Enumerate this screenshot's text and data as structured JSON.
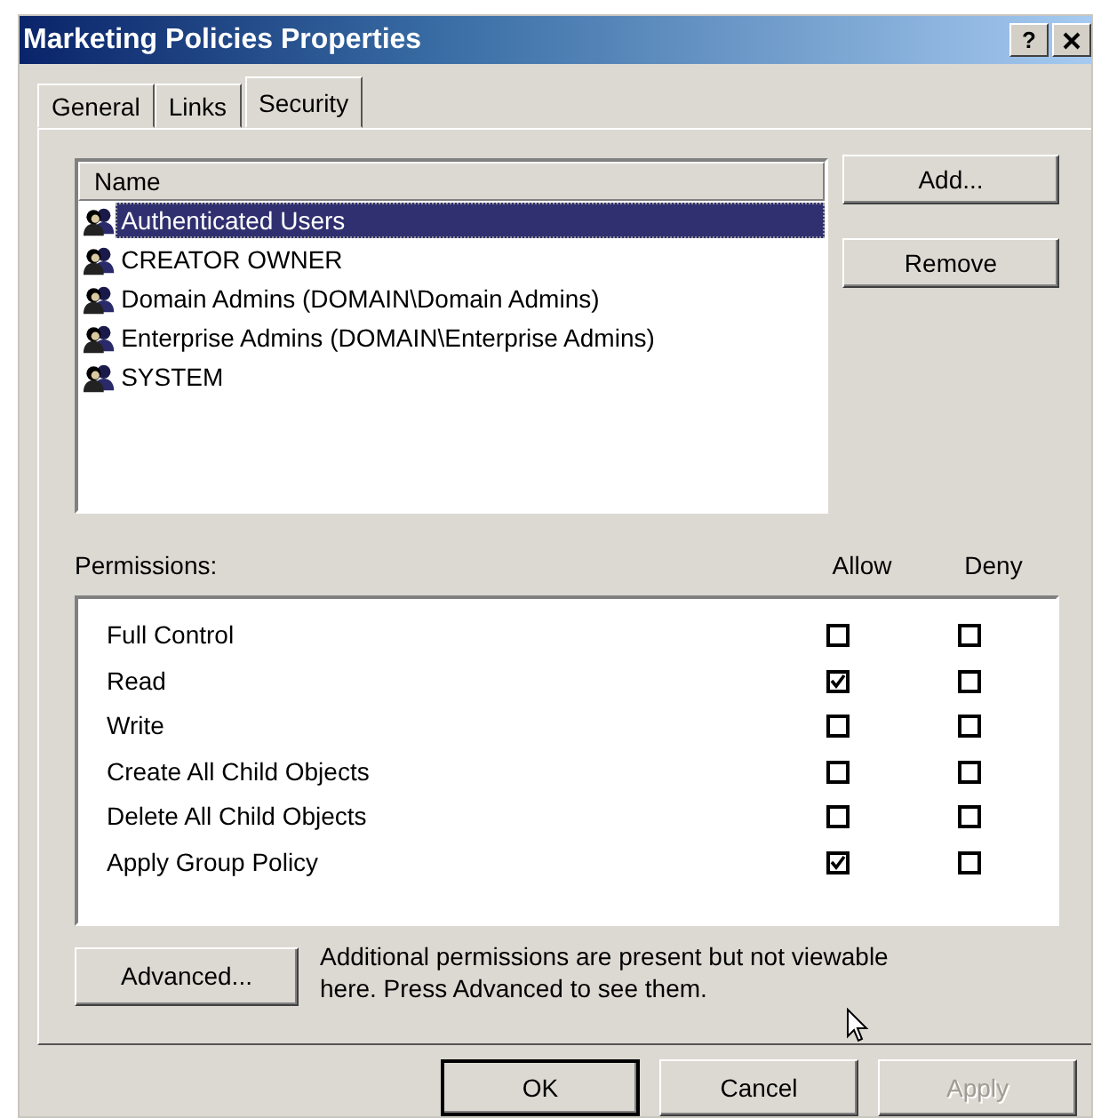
{
  "window": {
    "title": "Marketing Policies Properties",
    "help_button": "?"
  },
  "tabs": [
    {
      "label": "General",
      "selected": false
    },
    {
      "label": "Links",
      "selected": false
    },
    {
      "label": "Security",
      "selected": true
    }
  ],
  "users": {
    "column": "Name",
    "items": [
      {
        "name": "Authenticated Users",
        "selected": true
      },
      {
        "name": "CREATOR OWNER",
        "selected": false
      },
      {
        "name": "Domain Admins (DOMAIN\\Domain Admins)",
        "selected": false
      },
      {
        "name": "Enterprise Admins (DOMAIN\\Enterprise Admins)",
        "selected": false
      },
      {
        "name": "SYSTEM",
        "selected": false
      }
    ]
  },
  "user_buttons": [
    {
      "label": "Add...",
      "disabled": false
    },
    {
      "label": "Remove",
      "disabled": false
    }
  ],
  "permissions": {
    "label": "Permissions:",
    "allow_header": "Allow",
    "deny_header": "Deny",
    "rows": [
      {
        "name": "Full Control",
        "allow": false,
        "deny": false
      },
      {
        "name": "Read",
        "allow": true,
        "deny": false
      },
      {
        "name": "Write",
        "allow": false,
        "deny": false
      },
      {
        "name": "Create All Child Objects",
        "allow": false,
        "deny": false
      },
      {
        "name": "Delete All Child Objects",
        "allow": false,
        "deny": false
      },
      {
        "name": "Apply Group Policy",
        "allow": true,
        "deny": false
      }
    ]
  },
  "advanced": {
    "button": "Advanced...",
    "note": "Additional permissions are present but not viewable here. Press Advanced to see them."
  },
  "dialog_buttons": [
    {
      "label": "OK",
      "disabled": false,
      "default": true
    },
    {
      "label": "Cancel",
      "disabled": false,
      "default": false
    },
    {
      "label": "Apply",
      "disabled": true,
      "default": false
    }
  ]
}
